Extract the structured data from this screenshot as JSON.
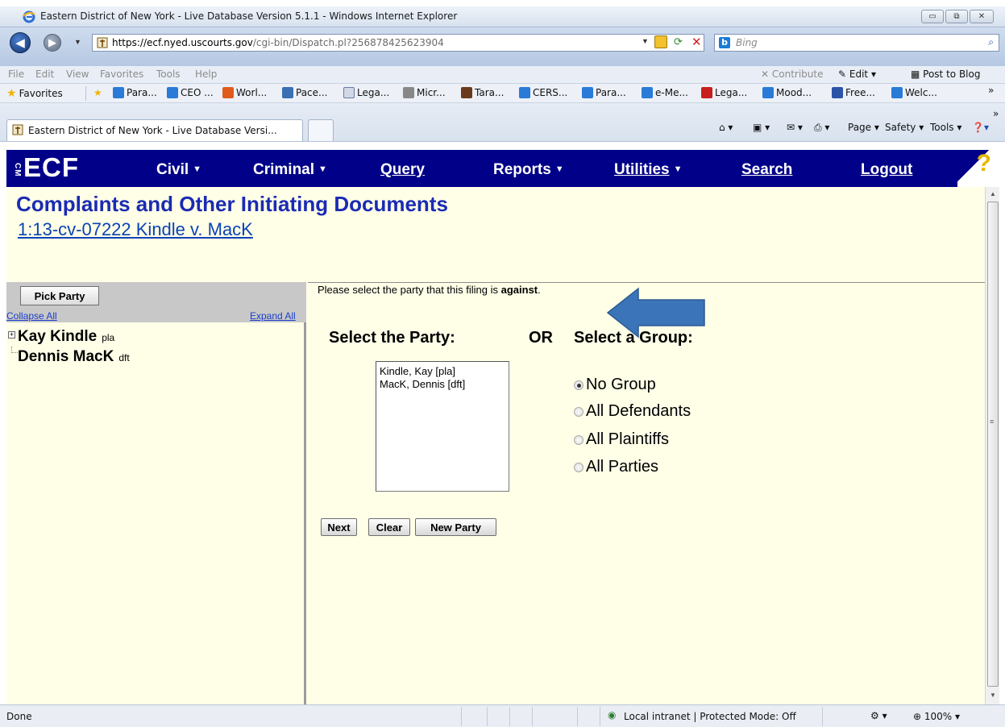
{
  "browser": {
    "window_title": "Eastern District of New York - Live Database Version 5.1.1 - Windows Internet Explorer",
    "url_host": "https://ecf.nyed.uscourts.gov",
    "url_path": "/cgi-bin/Dispatch.pl?256878425623904",
    "search_placeholder": "Bing",
    "menu": [
      "File",
      "Edit",
      "View",
      "Favorites",
      "Tools",
      "Help"
    ],
    "menu_right": {
      "contribute": "Contribute",
      "edit": "Edit",
      "post": "Post to Blog"
    },
    "favorites_label": "Favorites",
    "favorites": [
      "Para...",
      "CEO ...",
      "Worl...",
      "Pace...",
      "Lega...",
      "Micr...",
      "Tara...",
      "CERS...",
      "Para...",
      "e-Me...",
      "Lega...",
      "Mood...",
      "Free...",
      "Welc..."
    ],
    "tab_title": "Eastern District of New York - Live Database Versi...",
    "command_bar": {
      "page": "Page",
      "safety": "Safety",
      "tools": "Tools"
    },
    "status": {
      "left": "Done",
      "zone": "Local intranet | Protected Mode: Off",
      "zoom": "100%"
    }
  },
  "ecf": {
    "logo": "ECF",
    "logo_small": "CM",
    "nav": [
      {
        "label": "Civil",
        "dropdown": true
      },
      {
        "label": "Criminal",
        "dropdown": true
      },
      {
        "label": "Query",
        "dropdown": false
      },
      {
        "label": "Reports",
        "dropdown": true
      },
      {
        "label": "Utilities",
        "dropdown": true
      },
      {
        "label": "Search",
        "dropdown": false
      },
      {
        "label": "Logout",
        "dropdown": false
      }
    ],
    "help": "?"
  },
  "page": {
    "title": "Complaints and Other Initiating Documents",
    "case_link": "1:13-cv-07222 Kindle v. MacK"
  },
  "left_pane": {
    "pick_party": "Pick Party",
    "collapse_all": "Collapse All",
    "expand_all": "Expand All",
    "tree": [
      {
        "name": "Kay Kindle",
        "role": "pla",
        "expandable": true
      },
      {
        "name": "Dennis MacK",
        "role": "dft",
        "expandable": false
      }
    ]
  },
  "form": {
    "instruction_prefix": "Please select the party that this filing is ",
    "instruction_bold": "against",
    "instruction_suffix": ".",
    "select_party_label": "Select the Party:",
    "or_label": "OR",
    "select_group_label": "Select a Group:",
    "parties": [
      "Kindle, Kay  [pla]",
      "MacK, Dennis  [dft]"
    ],
    "groups": [
      {
        "label": "No Group",
        "checked": true
      },
      {
        "label": "All Defendants",
        "checked": false
      },
      {
        "label": "All Plaintiffs",
        "checked": false
      },
      {
        "label": "All Parties",
        "checked": false
      }
    ],
    "buttons": {
      "next": "Next",
      "clear": "Clear",
      "new_party": "New Party"
    }
  },
  "colors": {
    "ecf_nav": "#000088",
    "content_bg": "#ffffe8",
    "title": "#1a2bb3",
    "link": "#0a42b6",
    "annotation_arrow": "#3b74b8"
  }
}
